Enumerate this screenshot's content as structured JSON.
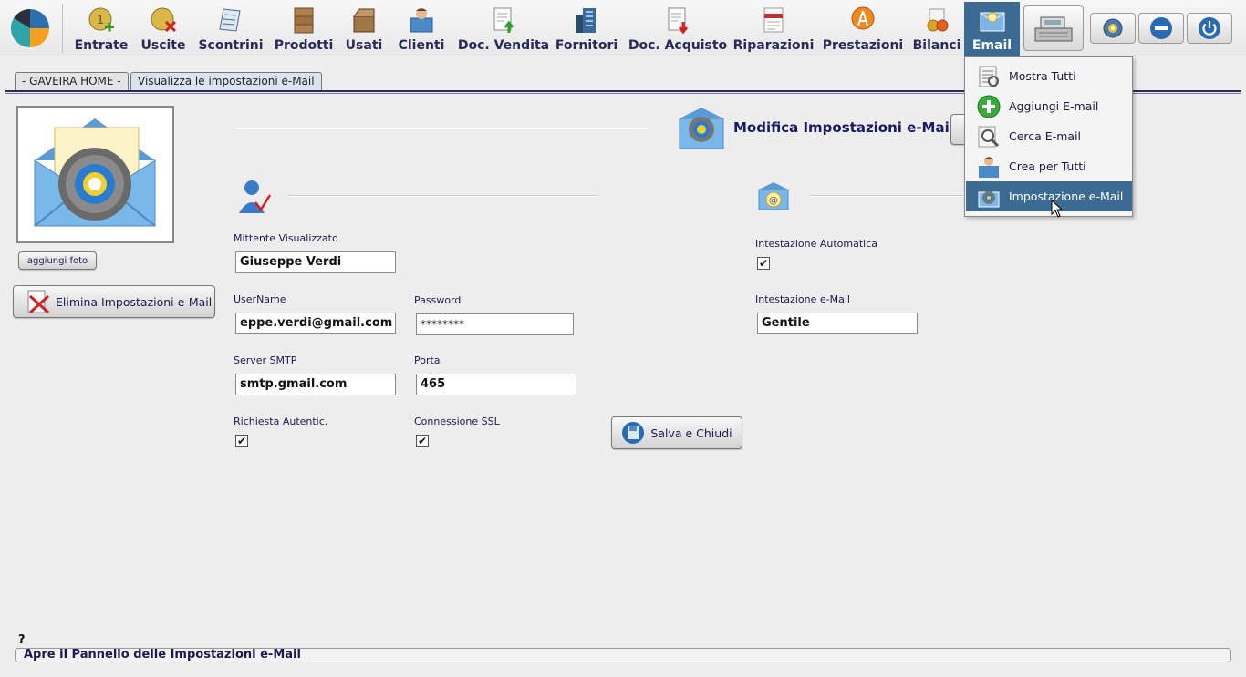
{
  "toolbar": {
    "items": [
      {
        "label": "Entrate",
        "icon": "coin-plus-icon"
      },
      {
        "label": "Uscite",
        "icon": "coin-minus-icon"
      },
      {
        "label": "Scontrini",
        "icon": "receipt-icon"
      },
      {
        "label": "Prodotti",
        "icon": "boxes-icon"
      },
      {
        "label": "Usati",
        "icon": "open-box-icon"
      },
      {
        "label": "Clienti",
        "icon": "customer-icon"
      },
      {
        "label": "Doc. Vendita",
        "icon": "document-out-icon"
      },
      {
        "label": "Fornitori",
        "icon": "building-icon"
      },
      {
        "label": "Doc. Acquisto",
        "icon": "document-in-icon"
      },
      {
        "label": "Riparazioni",
        "icon": "technical-icon"
      },
      {
        "label": "Prestazioni",
        "icon": "compass-icon"
      },
      {
        "label": "Bilanci",
        "icon": "balance-icon"
      },
      {
        "label": "Email",
        "icon": "email-icon"
      }
    ],
    "active_item": "Email",
    "system_buttons": [
      "cash-register-icon",
      "settings-icon",
      "minimize-icon",
      "power-icon"
    ]
  },
  "tabs": [
    {
      "label": "- GAVEIRA HOME -"
    },
    {
      "label": "Visualizza le impostazioni e-Mail"
    }
  ],
  "left_panel": {
    "add_photo_label": "aggiungi foto",
    "delete_label": "Elimina Impostazioni e-Mail"
  },
  "header": {
    "title": "Modifica Impostazioni e-Mail"
  },
  "form": {
    "sender_label": "Mittente Visualizzato",
    "sender_value": "Giuseppe Verdi",
    "username_label": "UserName",
    "username_value": "eppe.verdi@gmail.com",
    "password_label": "Password",
    "password_value": "********",
    "smtp_label": "Server SMTP",
    "smtp_value": "smtp.gmail.com",
    "port_label": "Porta",
    "port_value": "465",
    "auth_label": "Richiesta Autentic.",
    "auth_checked": true,
    "ssl_label": "Connessione SSL",
    "ssl_checked": true,
    "save_label": "Salva e Chiudi",
    "auto_header_label": "Intestazione Automatica",
    "auto_header_checked": true,
    "email_header_label": "Intestazione e-Mail",
    "email_header_value": "Gentile"
  },
  "dropdown": {
    "items": [
      {
        "label": "Mostra Tutti",
        "icon": "list-icon"
      },
      {
        "label": "Aggiungi E-mail",
        "icon": "add-icon"
      },
      {
        "label": "Cerca E-mail",
        "icon": "search-icon"
      },
      {
        "label": "Crea per Tutti",
        "icon": "create-all-icon"
      },
      {
        "label": "Impostazione e-Mail",
        "icon": "email-settings-icon"
      }
    ],
    "selected": "Impostazione e-Mail"
  },
  "status": {
    "help": "?",
    "text": "Apre il Pannello delle Impostazioni e-Mail"
  },
  "colors": {
    "accent": "#3b6a93",
    "text": "#1a1a50",
    "background": "#ededed"
  }
}
